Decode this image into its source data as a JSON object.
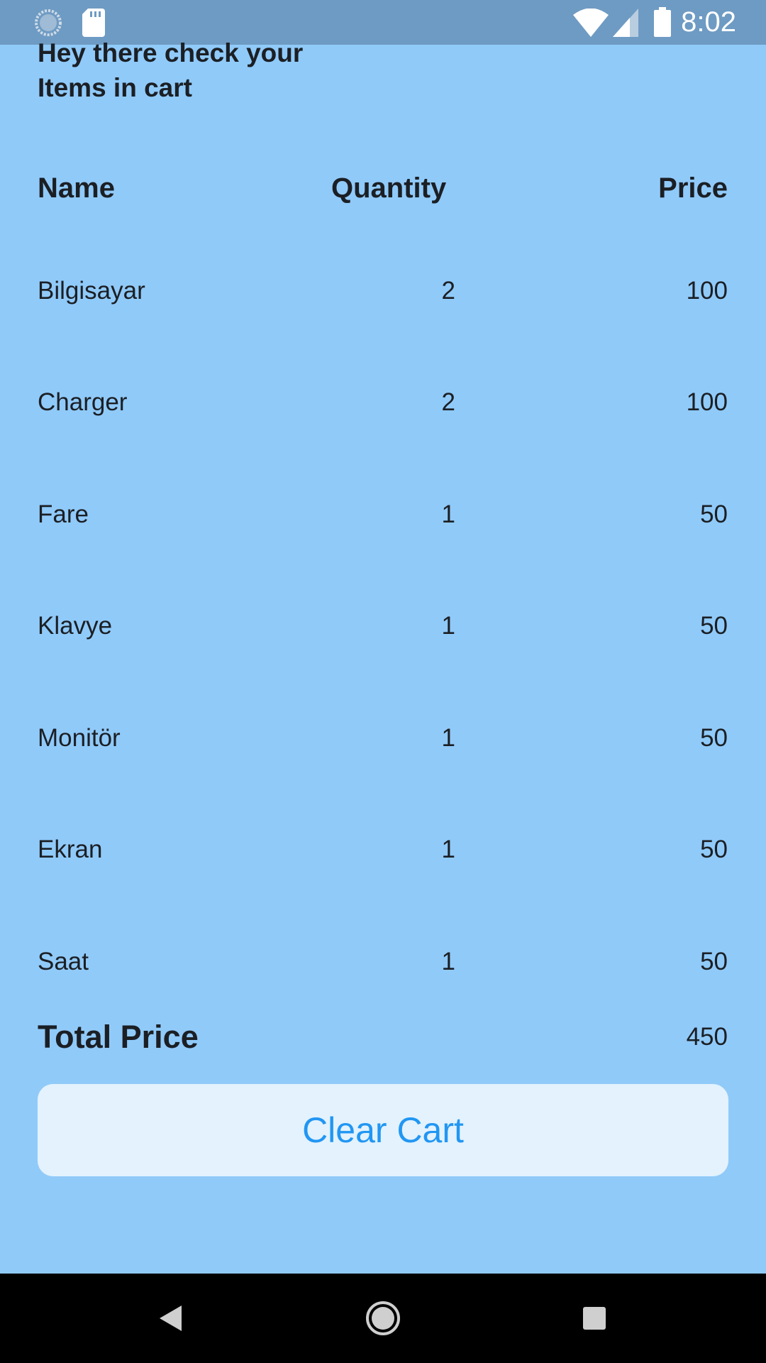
{
  "status_bar": {
    "time": "8:02",
    "icons": [
      "sync-icon",
      "sd-card-icon",
      "wifi-icon",
      "signal-icon",
      "battery-icon"
    ]
  },
  "header": {
    "greeting": "Hey there check your Items in cart"
  },
  "table": {
    "columns": [
      "Name",
      "Quantity",
      "Price"
    ],
    "rows": [
      {
        "name": "Bilgisayar",
        "quantity": "2",
        "price": "100"
      },
      {
        "name": "Charger",
        "quantity": "2",
        "price": "100"
      },
      {
        "name": "Fare",
        "quantity": "1",
        "price": "50"
      },
      {
        "name": "Klavye",
        "quantity": "1",
        "price": "50"
      },
      {
        "name": "Monitör",
        "quantity": "1",
        "price": "50"
      },
      {
        "name": "Ekran",
        "quantity": "1",
        "price": "50"
      },
      {
        "name": "Saat",
        "quantity": "1",
        "price": "50"
      }
    ]
  },
  "total": {
    "label": "Total Price",
    "value": "450"
  },
  "actions": {
    "clear_cart_label": "Clear Cart"
  },
  "colors": {
    "background": "#90caf9",
    "status_bar": "#6e9bc3",
    "button_bg": "#e3f2fd",
    "button_text": "#2196f3",
    "nav_bar": "#000000"
  },
  "nav_bar": {
    "buttons": [
      "back-icon",
      "home-icon",
      "recents-icon"
    ]
  }
}
